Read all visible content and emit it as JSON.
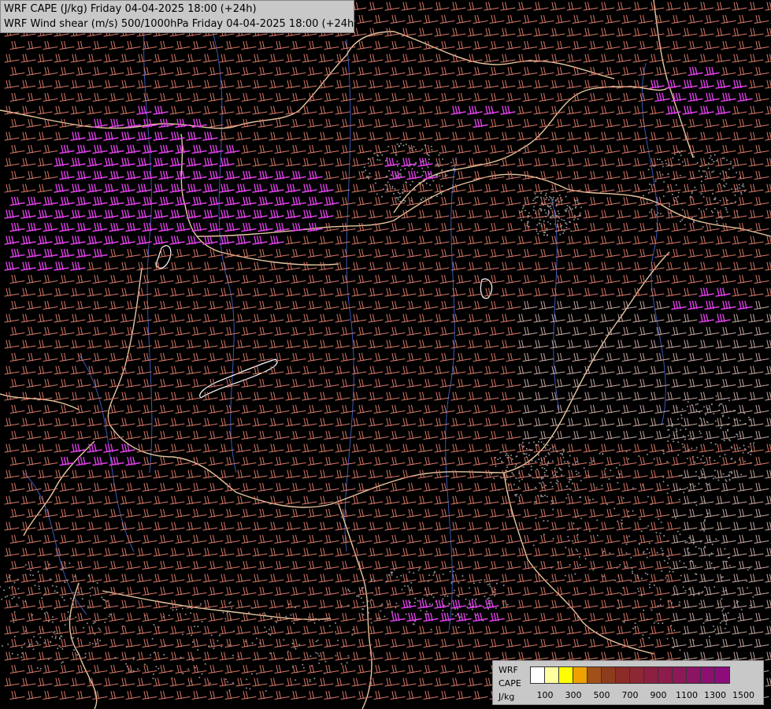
{
  "title_lines": [
    "WRF CAPE (J/kg) Friday 04-04-2025 18:00 (+24h)",
    "WRF Wind shear (m/s) 500/1000hPa Friday 04-04-2025 18:00 (+24h)"
  ],
  "legend": {
    "name_lines": [
      "WRF",
      "CAPE",
      "J/kg"
    ],
    "colors": [
      "#ffffff",
      "#ffffa0",
      "#ffff00",
      "#f0a000",
      "#a05018",
      "#8c3c1c",
      "#8c2c28",
      "#8c2834",
      "#8c2040",
      "#8c1c4c",
      "#8c1858",
      "#8c1464",
      "#8c1070",
      "#8c0c7c"
    ],
    "tick_labels": [
      "100",
      "300",
      "500",
      "700",
      "900",
      "1100",
      "1300",
      "1500"
    ]
  },
  "map_colors": {
    "background": "#000000",
    "border": "#e8c8a0",
    "river": "#3c5ab4",
    "barb_default": "#d97868",
    "barb_strong": "#e040e8",
    "barb_medium": "#c8a8a0",
    "barb_highlight": "#ffff20",
    "cloud_dots": "#909090"
  }
}
